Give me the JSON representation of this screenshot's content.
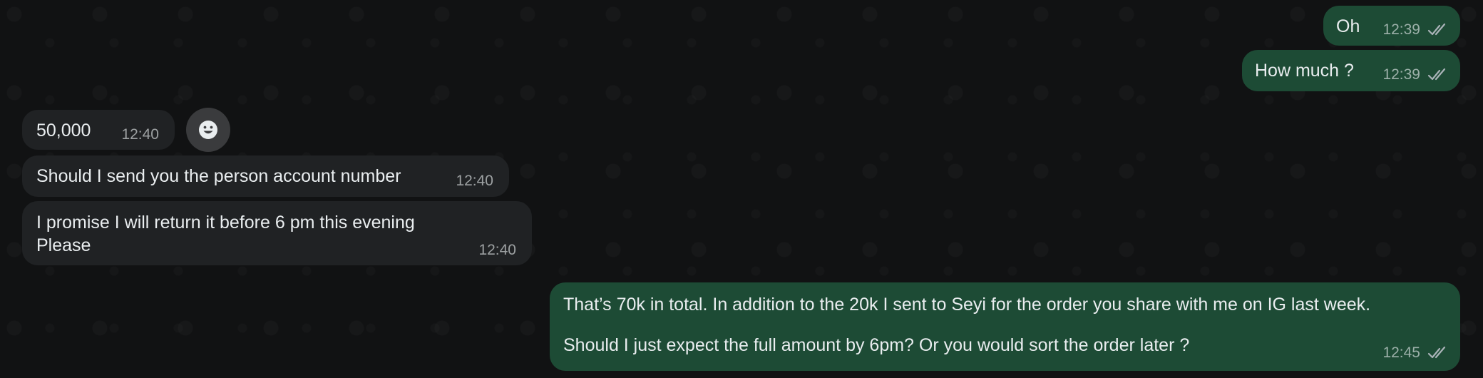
{
  "messages": [
    {
      "id": "m1",
      "direction": "outgoing",
      "text": "Oh",
      "time": "12:39",
      "status": "read"
    },
    {
      "id": "m2",
      "direction": "outgoing",
      "text": "How much ?",
      "time": "12:39",
      "status": "read"
    },
    {
      "id": "m3",
      "direction": "incoming",
      "text": "50,000",
      "time": "12:40"
    },
    {
      "id": "m4",
      "direction": "incoming",
      "text": "Should I send you the person account number",
      "time": "12:40"
    },
    {
      "id": "m5",
      "direction": "incoming",
      "lines": [
        "I promise I will return it before 6 pm this evening",
        "Please"
      ],
      "time": "12:40"
    },
    {
      "id": "m6",
      "direction": "outgoing",
      "lines": [
        "That’s 70k in total. In addition to the 20k I sent to Seyi for the order you share with me on IG last week.",
        "",
        "Should I just expect the full amount by 6pm? Or you would sort the order later ?"
      ],
      "time": "12:45",
      "status": "read"
    }
  ],
  "icons": {
    "read_receipt": "double-check-icon",
    "reaction": "smiley-icon"
  },
  "colors": {
    "background": "#111213",
    "incoming_bubble": "#202224",
    "outgoing_bubble": "#1d4b35",
    "text": "#e9edef",
    "meta_text": "#9aa2a6",
    "reaction_button": "#3a3b3d"
  }
}
